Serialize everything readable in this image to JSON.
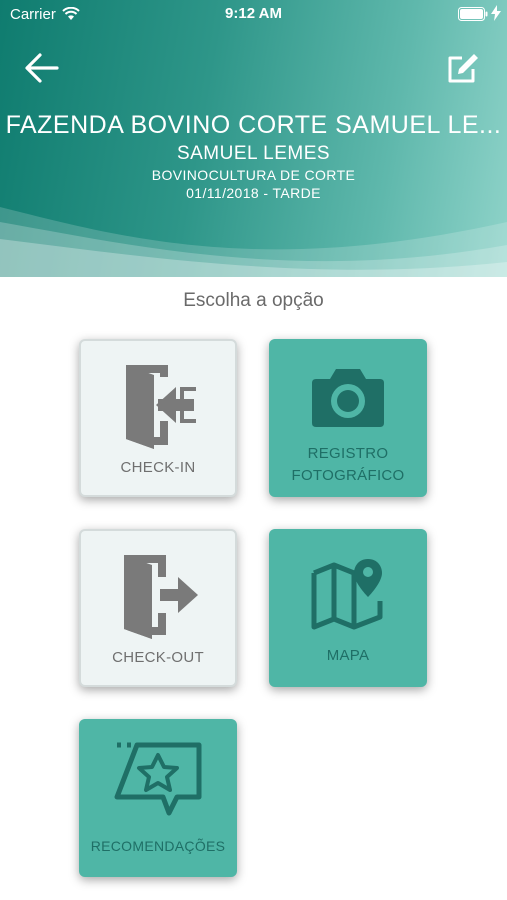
{
  "status_bar": {
    "carrier": "Carrier",
    "time": "9:12 AM"
  },
  "header": {
    "farm_title": "FAZENDA BOVINO CORTE SAMUEL LE...",
    "owner": "SAMUEL LEMES",
    "activity": "BOVINOCULTURA DE CORTE",
    "datetime": "01/11/2018 - TARDE",
    "back_icon": "arrow-left-icon",
    "edit_icon": "edit-icon"
  },
  "main": {
    "prompt": "Escolha a opção",
    "options": [
      {
        "label": "CHECK-IN",
        "icon": "door-enter-icon"
      },
      {
        "label_line1": "REGISTRO",
        "label_line2": "FOTOGRÁFICO",
        "icon": "camera-icon"
      },
      {
        "label": "CHECK-OUT",
        "icon": "door-exit-icon"
      },
      {
        "label": "MAPA",
        "icon": "map-pin-icon"
      },
      {
        "label": "RECOMENDAÇÕES",
        "icon": "star-message-icon"
      }
    ]
  },
  "colors": {
    "header_start": "#0f7c6f",
    "header_end": "#8fd3c9",
    "teal_tile": "#4fb6a6",
    "teal_icon": "#1f6f66",
    "light_tile": "#eef4f4",
    "gray_icon": "#7a7a7a"
  }
}
